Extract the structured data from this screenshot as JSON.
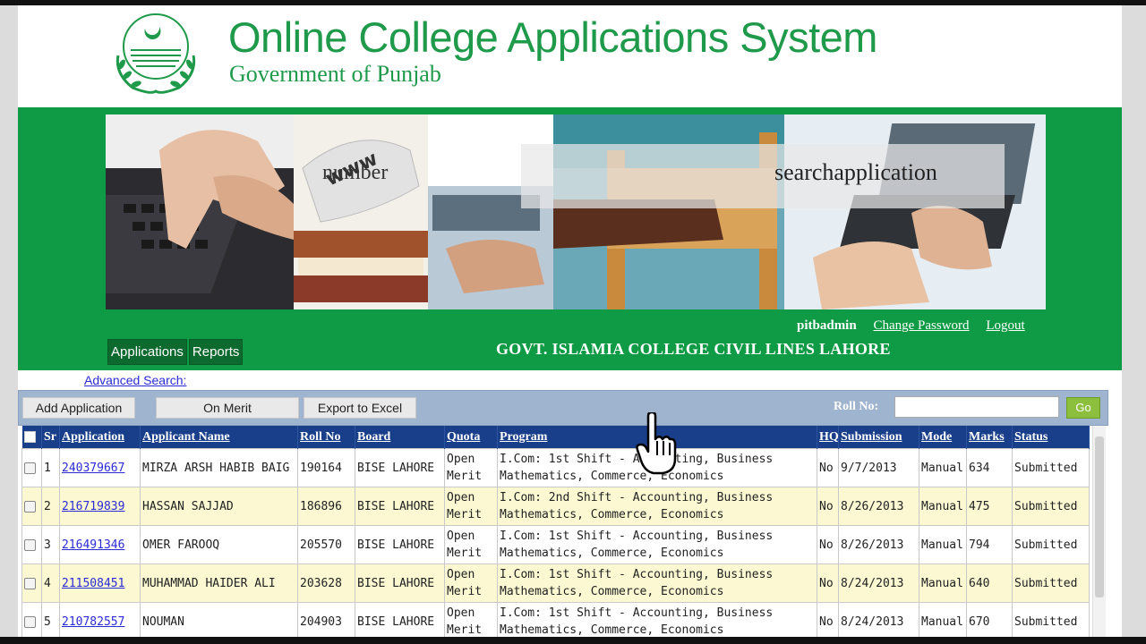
{
  "header": {
    "title": "Online College Applications System",
    "subtitle": "Government of Punjab",
    "banner_overlay_words": [
      "number",
      "searchapplication"
    ]
  },
  "userbar": {
    "username": "pitbadmin",
    "change_password": "Change Password",
    "logout": "Logout"
  },
  "nav": {
    "items": [
      {
        "label": "Applications"
      },
      {
        "label": "Reports"
      }
    ]
  },
  "college_name": "GOVT. ISLAMIA COLLEGE CIVIL LINES LAHORE",
  "advanced_search": "Advanced Search:",
  "toolbar": {
    "add_application": "Add Application",
    "on_merit": "On Merit",
    "export_excel": "Export to Excel",
    "roll_no_label": "Roll No:",
    "roll_no_value": "",
    "go": "Go"
  },
  "table": {
    "columns": [
      "Sr",
      "Application",
      "Applicant Name",
      "Roll No",
      "Board",
      "Quota",
      "Program",
      "HQ",
      "Submission",
      "Mode",
      "Marks",
      "Status"
    ],
    "rows": [
      {
        "sr": "1",
        "application": "240379667",
        "name": "MIRZA ARSH HABIB BAIG",
        "roll": "190164",
        "board": "BISE LAHORE",
        "quota": "Open Merit",
        "program": "I.Com: 1st Shift - Accounting, Business Mathematics, Commerce, Economics",
        "hq": "No",
        "submission": "9/7/2013",
        "mode": "Manual",
        "marks": "634",
        "status": "Submitted"
      },
      {
        "sr": "2",
        "application": "216719839",
        "name": "HASSAN SAJJAD",
        "roll": "186896",
        "board": "BISE LAHORE",
        "quota": "Open Merit",
        "program": "I.Com: 2nd Shift - Accounting, Business Mathematics, Commerce, Economics",
        "hq": "No",
        "submission": "8/26/2013",
        "mode": "Manual",
        "marks": "475",
        "status": "Submitted"
      },
      {
        "sr": "3",
        "application": "216491346",
        "name": "OMER FAROOQ",
        "roll": "205570",
        "board": "BISE LAHORE",
        "quota": "Open Merit",
        "program": "I.Com: 1st Shift - Accounting, Business Mathematics, Commerce, Economics",
        "hq": "No",
        "submission": "8/26/2013",
        "mode": "Manual",
        "marks": "794",
        "status": "Submitted"
      },
      {
        "sr": "4",
        "application": "211508451",
        "name": "MUHAMMAD HAIDER ALI",
        "roll": "203628",
        "board": "BISE LAHORE",
        "quota": "Open Merit",
        "program": "I.Com: 1st Shift - Accounting, Business Mathematics, Commerce, Economics",
        "hq": "No",
        "submission": "8/24/2013",
        "mode": "Manual",
        "marks": "640",
        "status": "Submitted"
      },
      {
        "sr": "5",
        "application": "210782557",
        "name": "NOUMAN",
        "roll": "204903",
        "board": "BISE LAHORE",
        "quota": "Open Merit",
        "program": "I.Com: 1st Shift - Accounting, Business Mathematics, Commerce, Economics",
        "hq": "No",
        "submission": "8/24/2013",
        "mode": "Manual",
        "marks": "670",
        "status": "Submitted"
      }
    ]
  },
  "colors": {
    "brand_green": "#0f9a45",
    "title_green": "#1e9a4a",
    "table_header": "#1a3f8a",
    "toolbar": "#9fb4cf",
    "alt_row": "#fbf8d2",
    "link": "#2b2bd6"
  },
  "icons": [
    "punjab-seal-logo",
    "hand-pointer-cursor"
  ]
}
